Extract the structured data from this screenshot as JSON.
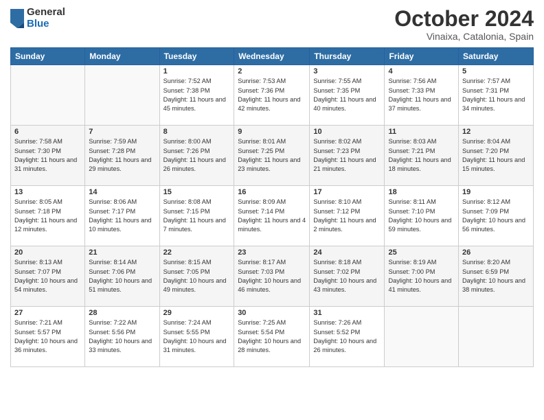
{
  "logo": {
    "general": "General",
    "blue": "Blue"
  },
  "title": "October 2024",
  "location": "Vinaixa, Catalonia, Spain",
  "header_days": [
    "Sunday",
    "Monday",
    "Tuesday",
    "Wednesday",
    "Thursday",
    "Friday",
    "Saturday"
  ],
  "weeks": [
    [
      {
        "day": "",
        "sunrise": "",
        "sunset": "",
        "daylight": ""
      },
      {
        "day": "",
        "sunrise": "",
        "sunset": "",
        "daylight": ""
      },
      {
        "day": "1",
        "sunrise": "Sunrise: 7:52 AM",
        "sunset": "Sunset: 7:38 PM",
        "daylight": "Daylight: 11 hours and 45 minutes."
      },
      {
        "day": "2",
        "sunrise": "Sunrise: 7:53 AM",
        "sunset": "Sunset: 7:36 PM",
        "daylight": "Daylight: 11 hours and 42 minutes."
      },
      {
        "day": "3",
        "sunrise": "Sunrise: 7:55 AM",
        "sunset": "Sunset: 7:35 PM",
        "daylight": "Daylight: 11 hours and 40 minutes."
      },
      {
        "day": "4",
        "sunrise": "Sunrise: 7:56 AM",
        "sunset": "Sunset: 7:33 PM",
        "daylight": "Daylight: 11 hours and 37 minutes."
      },
      {
        "day": "5",
        "sunrise": "Sunrise: 7:57 AM",
        "sunset": "Sunset: 7:31 PM",
        "daylight": "Daylight: 11 hours and 34 minutes."
      }
    ],
    [
      {
        "day": "6",
        "sunrise": "Sunrise: 7:58 AM",
        "sunset": "Sunset: 7:30 PM",
        "daylight": "Daylight: 11 hours and 31 minutes."
      },
      {
        "day": "7",
        "sunrise": "Sunrise: 7:59 AM",
        "sunset": "Sunset: 7:28 PM",
        "daylight": "Daylight: 11 hours and 29 minutes."
      },
      {
        "day": "8",
        "sunrise": "Sunrise: 8:00 AM",
        "sunset": "Sunset: 7:26 PM",
        "daylight": "Daylight: 11 hours and 26 minutes."
      },
      {
        "day": "9",
        "sunrise": "Sunrise: 8:01 AM",
        "sunset": "Sunset: 7:25 PM",
        "daylight": "Daylight: 11 hours and 23 minutes."
      },
      {
        "day": "10",
        "sunrise": "Sunrise: 8:02 AM",
        "sunset": "Sunset: 7:23 PM",
        "daylight": "Daylight: 11 hours and 21 minutes."
      },
      {
        "day": "11",
        "sunrise": "Sunrise: 8:03 AM",
        "sunset": "Sunset: 7:21 PM",
        "daylight": "Daylight: 11 hours and 18 minutes."
      },
      {
        "day": "12",
        "sunrise": "Sunrise: 8:04 AM",
        "sunset": "Sunset: 7:20 PM",
        "daylight": "Daylight: 11 hours and 15 minutes."
      }
    ],
    [
      {
        "day": "13",
        "sunrise": "Sunrise: 8:05 AM",
        "sunset": "Sunset: 7:18 PM",
        "daylight": "Daylight: 11 hours and 12 minutes."
      },
      {
        "day": "14",
        "sunrise": "Sunrise: 8:06 AM",
        "sunset": "Sunset: 7:17 PM",
        "daylight": "Daylight: 11 hours and 10 minutes."
      },
      {
        "day": "15",
        "sunrise": "Sunrise: 8:08 AM",
        "sunset": "Sunset: 7:15 PM",
        "daylight": "Daylight: 11 hours and 7 minutes."
      },
      {
        "day": "16",
        "sunrise": "Sunrise: 8:09 AM",
        "sunset": "Sunset: 7:14 PM",
        "daylight": "Daylight: 11 hours and 4 minutes."
      },
      {
        "day": "17",
        "sunrise": "Sunrise: 8:10 AM",
        "sunset": "Sunset: 7:12 PM",
        "daylight": "Daylight: 11 hours and 2 minutes."
      },
      {
        "day": "18",
        "sunrise": "Sunrise: 8:11 AM",
        "sunset": "Sunset: 7:10 PM",
        "daylight": "Daylight: 10 hours and 59 minutes."
      },
      {
        "day": "19",
        "sunrise": "Sunrise: 8:12 AM",
        "sunset": "Sunset: 7:09 PM",
        "daylight": "Daylight: 10 hours and 56 minutes."
      }
    ],
    [
      {
        "day": "20",
        "sunrise": "Sunrise: 8:13 AM",
        "sunset": "Sunset: 7:07 PM",
        "daylight": "Daylight: 10 hours and 54 minutes."
      },
      {
        "day": "21",
        "sunrise": "Sunrise: 8:14 AM",
        "sunset": "Sunset: 7:06 PM",
        "daylight": "Daylight: 10 hours and 51 minutes."
      },
      {
        "day": "22",
        "sunrise": "Sunrise: 8:15 AM",
        "sunset": "Sunset: 7:05 PM",
        "daylight": "Daylight: 10 hours and 49 minutes."
      },
      {
        "day": "23",
        "sunrise": "Sunrise: 8:17 AM",
        "sunset": "Sunset: 7:03 PM",
        "daylight": "Daylight: 10 hours and 46 minutes."
      },
      {
        "day": "24",
        "sunrise": "Sunrise: 8:18 AM",
        "sunset": "Sunset: 7:02 PM",
        "daylight": "Daylight: 10 hours and 43 minutes."
      },
      {
        "day": "25",
        "sunrise": "Sunrise: 8:19 AM",
        "sunset": "Sunset: 7:00 PM",
        "daylight": "Daylight: 10 hours and 41 minutes."
      },
      {
        "day": "26",
        "sunrise": "Sunrise: 8:20 AM",
        "sunset": "Sunset: 6:59 PM",
        "daylight": "Daylight: 10 hours and 38 minutes."
      }
    ],
    [
      {
        "day": "27",
        "sunrise": "Sunrise: 7:21 AM",
        "sunset": "Sunset: 5:57 PM",
        "daylight": "Daylight: 10 hours and 36 minutes."
      },
      {
        "day": "28",
        "sunrise": "Sunrise: 7:22 AM",
        "sunset": "Sunset: 5:56 PM",
        "daylight": "Daylight: 10 hours and 33 minutes."
      },
      {
        "day": "29",
        "sunrise": "Sunrise: 7:24 AM",
        "sunset": "Sunset: 5:55 PM",
        "daylight": "Daylight: 10 hours and 31 minutes."
      },
      {
        "day": "30",
        "sunrise": "Sunrise: 7:25 AM",
        "sunset": "Sunset: 5:54 PM",
        "daylight": "Daylight: 10 hours and 28 minutes."
      },
      {
        "day": "31",
        "sunrise": "Sunrise: 7:26 AM",
        "sunset": "Sunset: 5:52 PM",
        "daylight": "Daylight: 10 hours and 26 minutes."
      },
      {
        "day": "",
        "sunrise": "",
        "sunset": "",
        "daylight": ""
      },
      {
        "day": "",
        "sunrise": "",
        "sunset": "",
        "daylight": ""
      }
    ]
  ]
}
